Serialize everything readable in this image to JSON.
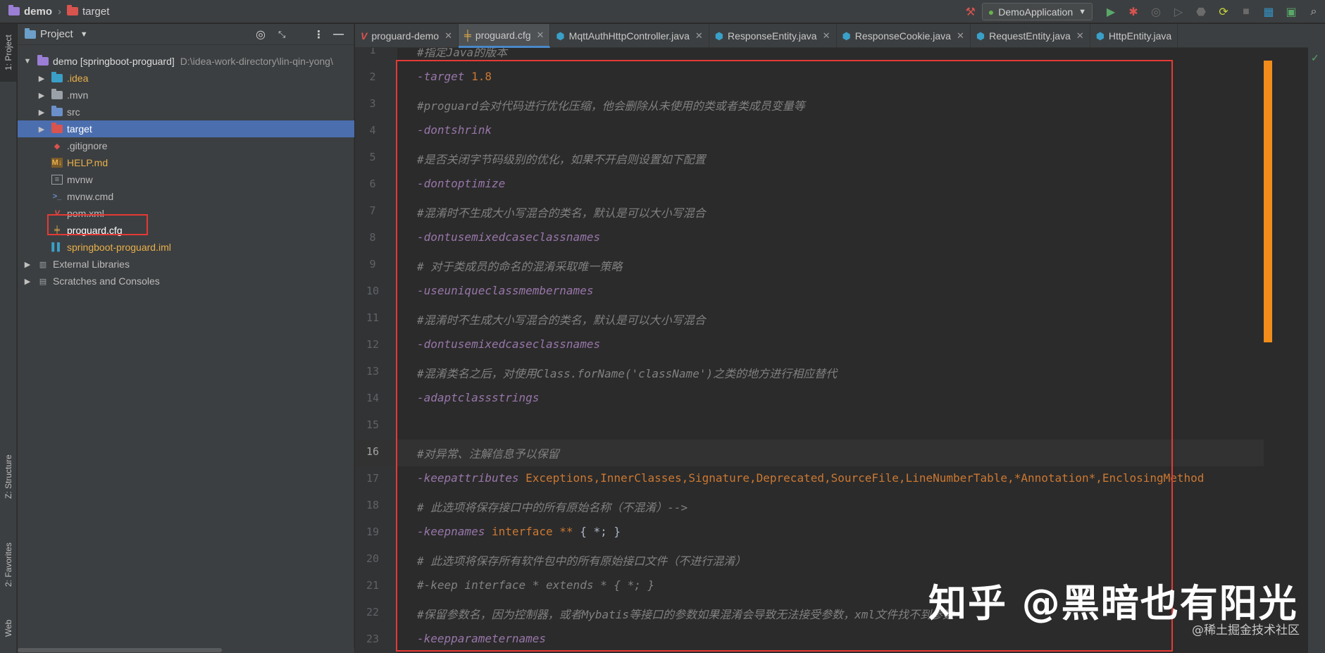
{
  "navbar": {
    "project": "demo",
    "folder": "target",
    "run_config": "DemoApplication"
  },
  "left_strip": {
    "project_tab": "1: Project",
    "structure_tab": "Z: Structure",
    "favorites_tab": "2: Favorites",
    "web_tab": "Web"
  },
  "project_panel": {
    "header": "Project",
    "root_label": "demo [springboot-proguard]",
    "root_path": "D:\\idea-work-directory\\lin-qin-yong\\",
    "items": [
      {
        "label": ".idea",
        "color": "#e8b04a"
      },
      {
        "label": ".mvn",
        "color": "#bbbbbb"
      },
      {
        "label": "src",
        "color": "#bbbbbb"
      },
      {
        "label": "target",
        "color": "#ffffff"
      },
      {
        "label": ".gitignore",
        "color": "#bbbbbb"
      },
      {
        "label": "HELP.md",
        "color": "#e8b04a"
      },
      {
        "label": "mvnw",
        "color": "#bbbbbb"
      },
      {
        "label": "mvnw.cmd",
        "color": "#bbbbbb"
      },
      {
        "label": "pom.xml",
        "color": "#bbbbbb"
      },
      {
        "label": "proguard.cfg",
        "color": "#ffffff"
      },
      {
        "label": "springboot-proguard.iml",
        "color": "#e8b04a"
      }
    ],
    "external_libraries": "External Libraries",
    "scratches": "Scratches and Consoles"
  },
  "tabs": [
    {
      "label": "proguard-demo",
      "icon": "maven-icon",
      "active": false
    },
    {
      "label": "proguard.cfg",
      "icon": "config-icon",
      "active": true
    },
    {
      "label": "MqttAuthHttpController.java",
      "icon": "class-icon",
      "active": false
    },
    {
      "label": "ResponseEntity.java",
      "icon": "class-icon",
      "active": false
    },
    {
      "label": "ResponseCookie.java",
      "icon": "class-icon",
      "active": false
    },
    {
      "label": "RequestEntity.java",
      "icon": "class-icon",
      "active": false
    },
    {
      "label": "HttpEntity.java",
      "icon": "class-icon",
      "active": false
    }
  ],
  "editor": {
    "current_line": 16,
    "lines": [
      {
        "n": "1",
        "parts": [
          {
            "t": "#指定Java的版本",
            "c": "cm"
          }
        ]
      },
      {
        "n": "2",
        "parts": [
          {
            "t": "-target ",
            "c": "kw"
          },
          {
            "t": "1.8",
            "c": "val"
          }
        ]
      },
      {
        "n": "3",
        "parts": [
          {
            "t": "#proguard会对代码进行优化压缩，他会删除从未使用的类或者类成员变量等",
            "c": "cm"
          }
        ]
      },
      {
        "n": "4",
        "parts": [
          {
            "t": "-dontshrink",
            "c": "kw"
          }
        ]
      },
      {
        "n": "5",
        "parts": [
          {
            "t": "#是否关闭字节码级别的优化，如果不开启则设置如下配置",
            "c": "cm"
          }
        ]
      },
      {
        "n": "6",
        "parts": [
          {
            "t": "-dontoptimize",
            "c": "kw"
          }
        ]
      },
      {
        "n": "7",
        "parts": [
          {
            "t": "#混淆时不生成大小写混合的类名，默认是可以大小写混合",
            "c": "cm"
          }
        ]
      },
      {
        "n": "8",
        "parts": [
          {
            "t": "-dontusemixedcaseclassnames",
            "c": "kw"
          }
        ]
      },
      {
        "n": "9",
        "parts": [
          {
            "t": "# 对于类成员的命名的混淆采取唯一策略",
            "c": "cm"
          }
        ]
      },
      {
        "n": "10",
        "parts": [
          {
            "t": "-useuniqueclassmembernames",
            "c": "kw"
          }
        ]
      },
      {
        "n": "11",
        "parts": [
          {
            "t": "#混淆时不生成大小写混合的类名，默认是可以大小写混合",
            "c": "cm"
          }
        ]
      },
      {
        "n": "12",
        "parts": [
          {
            "t": "-dontusemixedcaseclassnames",
            "c": "kw"
          }
        ]
      },
      {
        "n": "13",
        "parts": [
          {
            "t": "#混淆类名之后，对使用Class.forName('className')之类的地方进行相应替代",
            "c": "cm"
          }
        ]
      },
      {
        "n": "14",
        "parts": [
          {
            "t": "-adaptclassstrings",
            "c": "kw"
          }
        ]
      },
      {
        "n": "15",
        "parts": []
      },
      {
        "n": "16",
        "parts": [
          {
            "t": "#对异常、注解信息予以保留",
            "c": "cm"
          }
        ]
      },
      {
        "n": "17",
        "parts": [
          {
            "t": "-keepattributes ",
            "c": "kw"
          },
          {
            "t": "Exceptions,InnerClasses,Signature,Deprecated,SourceFile,LineNumberTable,*Annotation*,EnclosingMethod",
            "c": "val"
          }
        ]
      },
      {
        "n": "18",
        "parts": [
          {
            "t": "# 此选项将保存接口中的所有原始名称（不混淆）-->",
            "c": "cm"
          }
        ]
      },
      {
        "n": "19",
        "parts": [
          {
            "t": "-keepnames ",
            "c": "kw"
          },
          {
            "t": "interface ",
            "c": "kw2"
          },
          {
            "t": "** ",
            "c": "val"
          },
          {
            "t": "{ *; }",
            "c": "plain"
          }
        ]
      },
      {
        "n": "20",
        "parts": [
          {
            "t": "# 此选项将保存所有软件包中的所有原始接口文件（不进行混淆）",
            "c": "cm"
          }
        ]
      },
      {
        "n": "21",
        "parts": [
          {
            "t": "#-keep interface * extends * { *; }",
            "c": "cm"
          }
        ]
      },
      {
        "n": "22",
        "parts": [
          {
            "t": "#保留参数名，因为控制器，或者Mybatis等接口的参数如果混淆会导致无法接受参数，xml文件找不到参数",
            "c": "cm"
          }
        ]
      },
      {
        "n": "23",
        "parts": [
          {
            "t": "-keepparameternames",
            "c": "kw"
          }
        ]
      }
    ]
  },
  "watermark": {
    "main": "知乎 @黑暗也有阳光",
    "sub": "@稀土掘金技术社区"
  }
}
